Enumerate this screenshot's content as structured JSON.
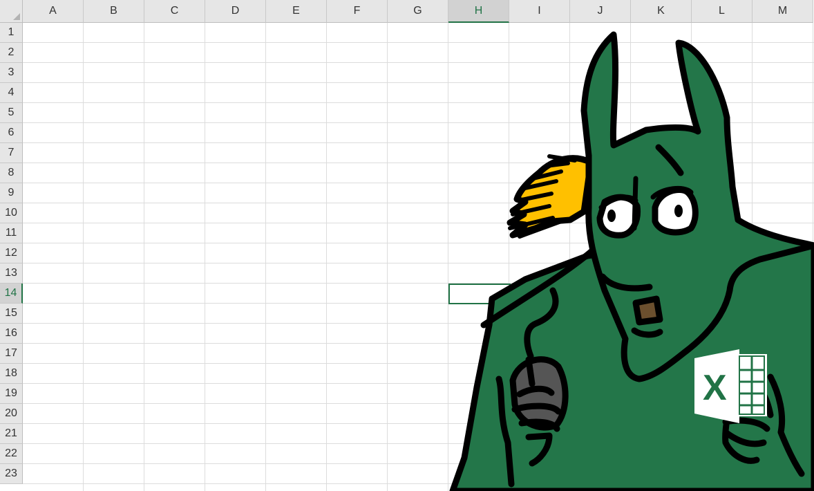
{
  "columns": [
    "A",
    "B",
    "C",
    "D",
    "E",
    "F",
    "G",
    "H",
    "I",
    "J",
    "K",
    "L",
    "M"
  ],
  "rows": [
    "1",
    "2",
    "3",
    "4",
    "5",
    "6",
    "7",
    "8",
    "9",
    "10",
    "11",
    "12",
    "13",
    "14",
    "15",
    "16",
    "17",
    "18",
    "19",
    "20",
    "21",
    "22",
    "23"
  ],
  "selection": {
    "column": "H",
    "row": "14"
  },
  "colors": {
    "excel_green": "#217346",
    "grid_line": "#dcdcdc",
    "header_bg": "#e6e6e6",
    "creature_green": "#237649",
    "flame_orange": "#ffc000"
  },
  "illustration": {
    "subject": "green horned creature holding a computer mouse and the Excel logo",
    "logo_letter": "X"
  }
}
